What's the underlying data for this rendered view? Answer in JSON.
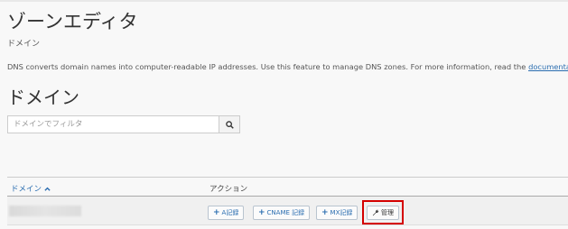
{
  "header": {
    "title": "ゾーンエディタ",
    "breadcrumb": "ドメイン"
  },
  "intro": {
    "text": "DNS converts domain names into computer-readable IP addresses. Use this feature to manage DNS zones. For more information, read the ",
    "link": "documentation",
    "suffix": "."
  },
  "section": {
    "title": "ドメイン"
  },
  "filter": {
    "placeholder": "ドメインでフィルタ",
    "value": "",
    "search_icon": "search-icon"
  },
  "table": {
    "columns": {
      "domain": "ドメイン",
      "actions": "アクション"
    },
    "sort_icon": "chevron-up-icon",
    "rows": [
      {
        "buttons": {
          "a_record": "A記録",
          "cname_record": "CNAME 記録",
          "mx_record": "MX記録",
          "manage": "管理"
        }
      }
    ]
  },
  "colors": {
    "link": "#2a6db0",
    "highlight": "#d40000",
    "background": "#f8f8f8"
  }
}
